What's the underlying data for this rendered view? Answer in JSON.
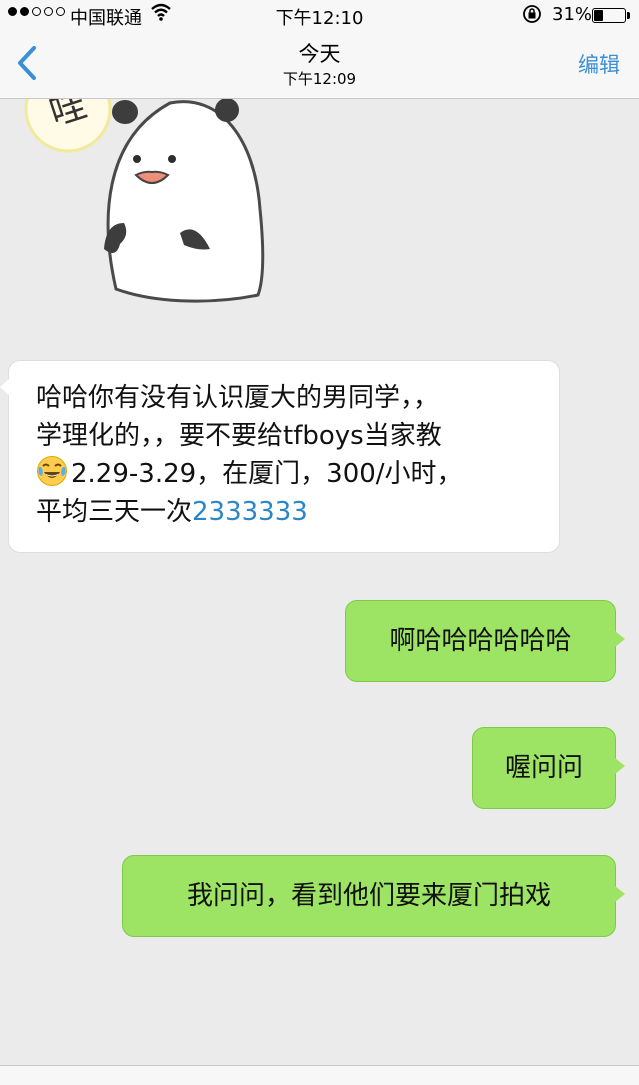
{
  "status_bar": {
    "carrier": "中国联通",
    "time": "下午12:10",
    "battery_percent": "31%",
    "battery_level": 0.31,
    "signal_bars_filled": 2,
    "signal_bars_total": 5
  },
  "nav": {
    "back_icon": "chevron-left-icon",
    "title": "今天",
    "subtitle": "下午12:09",
    "edit_label": "编辑"
  },
  "messages": [
    {
      "direction": "incoming",
      "lines": [
        "哈哈你有没有认识厦大的男同学，，",
        "学理化的，，要不要给tfboys当家教",
        "2.29-3.29，在厦门，300/小时，",
        "平均三天一次"
      ],
      "link_text": "2333333",
      "emoji": "face-with-tears-of-joy"
    },
    {
      "direction": "outgoing",
      "text": "啊哈哈哈哈哈哈"
    },
    {
      "direction": "outgoing",
      "text": "喔问问"
    },
    {
      "direction": "outgoing",
      "text": "我问问，看到他们要来厦门拍戏"
    }
  ],
  "sticker": {
    "name": "panda-sticker",
    "caption_fragment": "哇"
  },
  "colors": {
    "accent": "#3a8fd6",
    "outgoing_bubble": "#9de364",
    "incoming_bubble": "#ffffff",
    "chat_background": "#ebebeb",
    "link": "#2b86c8"
  }
}
